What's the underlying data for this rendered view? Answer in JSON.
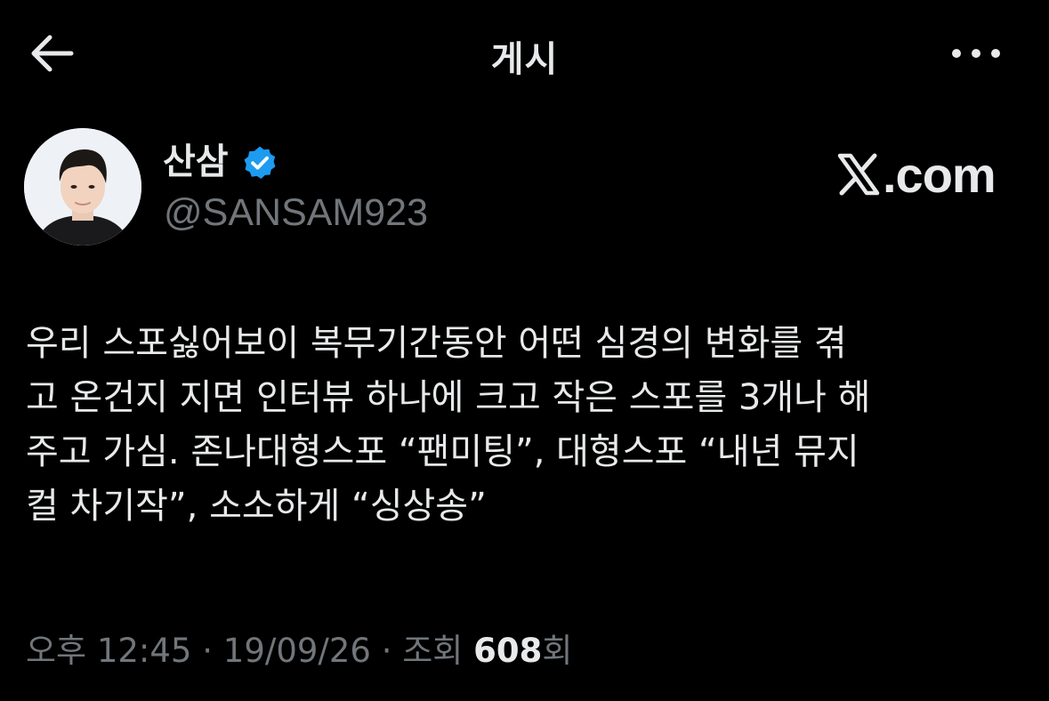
{
  "header": {
    "title": "게시",
    "back_icon": "arrow-left-icon",
    "more_icon": "more-horizontal-icon"
  },
  "author": {
    "display_name": "산삼",
    "handle": "@SANSAM923",
    "verified": true,
    "verified_color": "#1d9bf0"
  },
  "watermark": {
    "text": ".com"
  },
  "tweet": {
    "text": "우리 스포싫어보이 복무기간동안 어떤 심경의 변화를 겪\n고 온건지 지면 인터뷰 하나에 크고 작은 스포를 3개나 해\n주고 가심. 존나대형스포 “팬미팅”, 대형스포 “내년 뮤지\n컬 차기작”, 소소하게 “싱상송”"
  },
  "meta": {
    "time": "오후 12:45",
    "separator": " · ",
    "date": "19/09/26",
    "views_label": "조회 ",
    "views_count": "608",
    "views_suffix": "회"
  },
  "colors": {
    "background": "#000000",
    "text_primary": "#e7e9ea",
    "text_secondary": "#71767b"
  }
}
